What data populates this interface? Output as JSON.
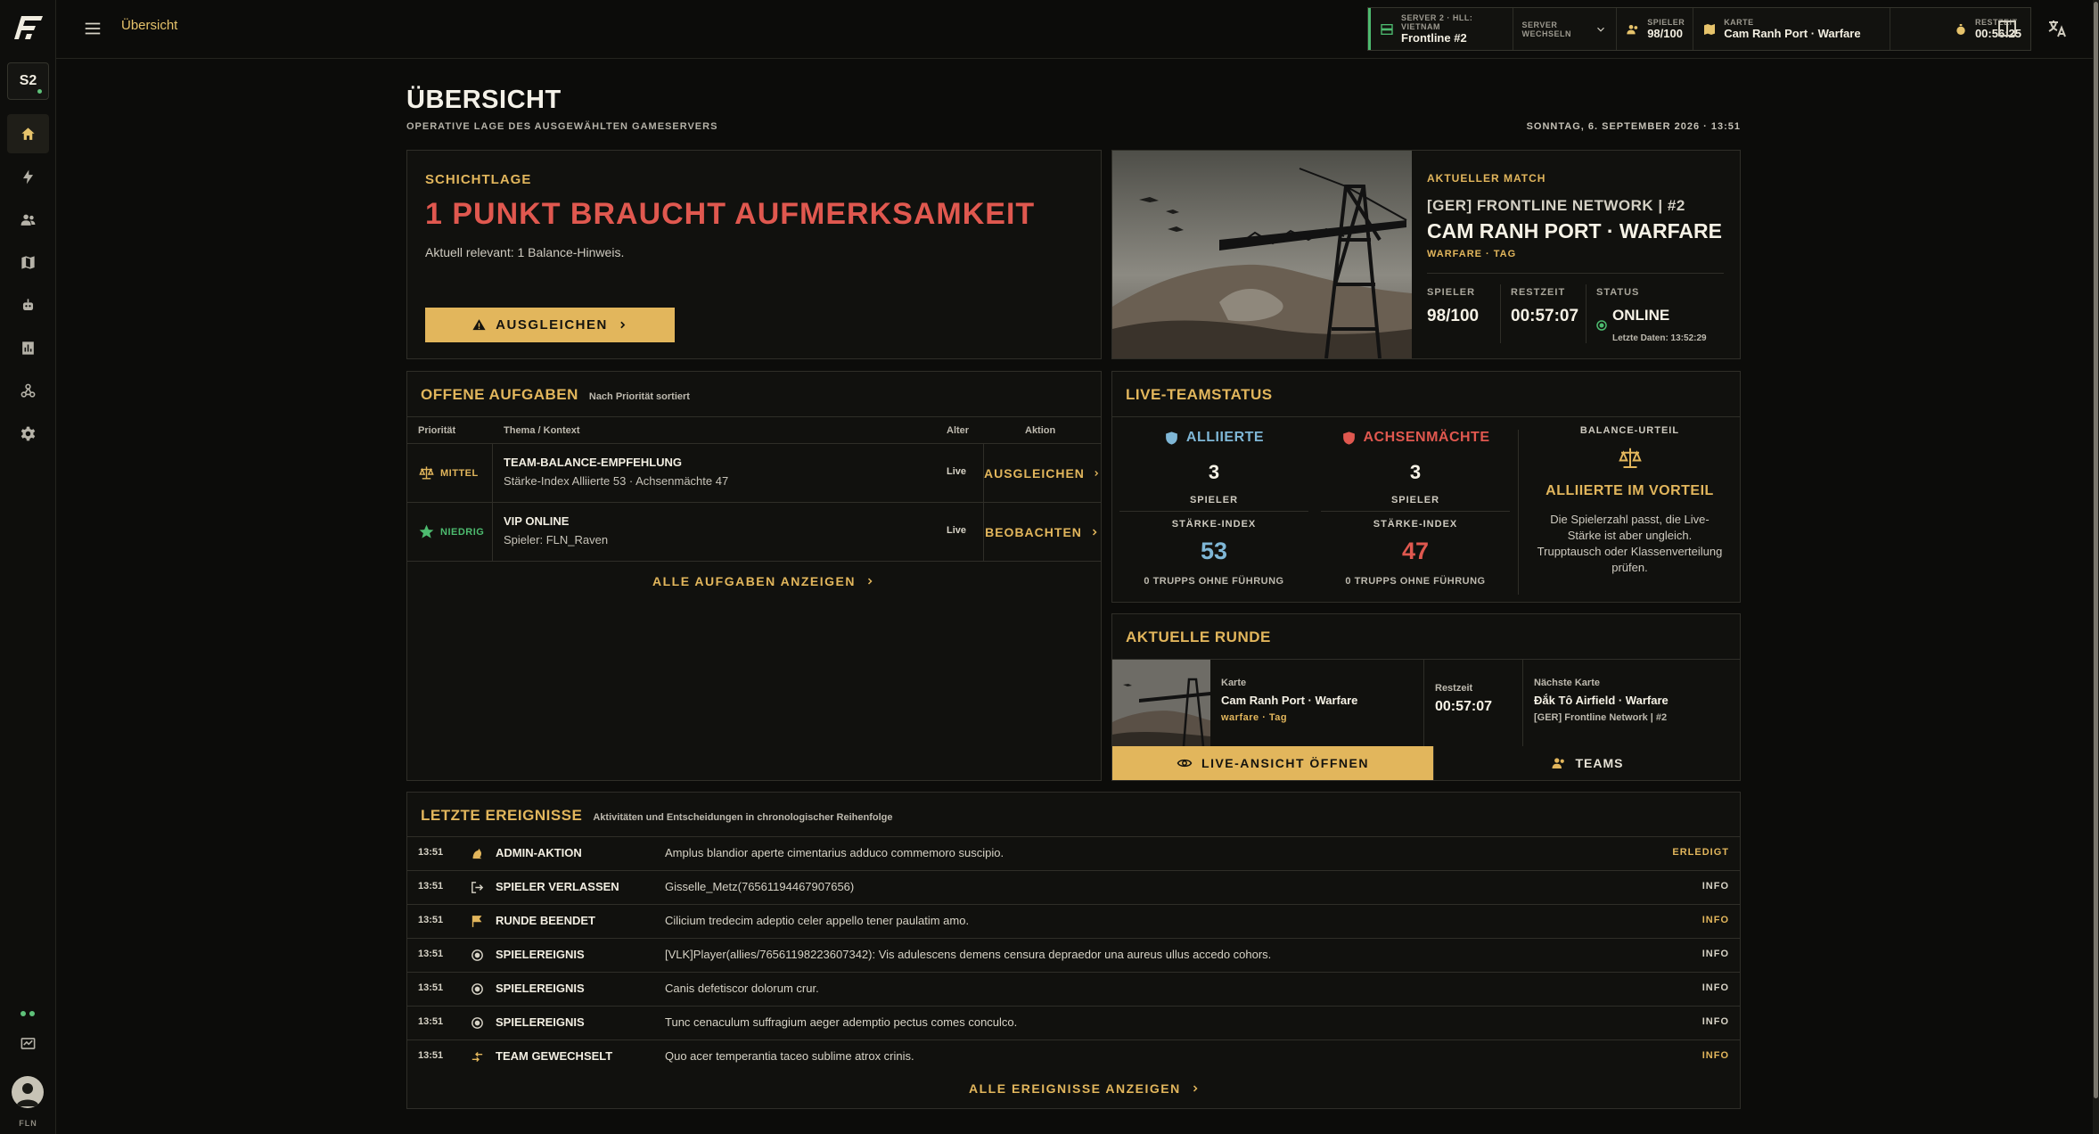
{
  "sidebar": {
    "server_badge": "S2",
    "user_label": "FLN"
  },
  "topbar": {
    "breadcrumb": "Übersicht"
  },
  "hud": {
    "server_label": "SERVER 2 · HLL: VIETNAM",
    "server_name": "Frontline #2",
    "switch_label": "SERVER WECHSELN",
    "players_label": "SPIELER",
    "players_value": "98/100",
    "map_label": "KARTE",
    "map_value": "Cam Ranh Port · Warfare",
    "time_label": "RESTZEIT",
    "time_value": "00:56:25"
  },
  "page": {
    "title": "ÜBERSICHT",
    "subtitle": "OPERATIVE LAGE DES AUSGEWÄHLTEN GAMESERVERS",
    "date": "SONNTAG, 6. SEPTEMBER 2026 · 13:51"
  },
  "alert": {
    "kicker": "SCHICHTLAGE",
    "title": "1 PUNKT BRAUCHT AUFMERKSAMKEIT",
    "text": "Aktuell relevant: 1 Balance-Hinweis.",
    "button": "AUSGLEICHEN"
  },
  "match": {
    "kicker": "AKTUELLER MATCH",
    "server": "[GER] FRONTLINE NETWORK | #2",
    "map": "CAM RANH PORT · WARFARE",
    "mode": "WARFARE · TAG",
    "players_label": "SPIELER",
    "players_value": "98/100",
    "time_label": "RESTZEIT",
    "time_value": "00:57:07",
    "status_label": "STATUS",
    "status_value": "ONLINE",
    "last_data": "Letzte Daten: 13:52:29"
  },
  "tasks": {
    "title": "OFFENE AUFGABEN",
    "sort": "Nach Priorität sortiert",
    "col_priority": "Priorität",
    "col_topic": "Thema / Kontext",
    "col_age": "Alter",
    "col_action": "Aktion",
    "rows": [
      {
        "priority": "MITTEL",
        "title": "TEAM-BALANCE-EMPFEHLUNG",
        "sub": "Stärke-Index Alliierte 53 · Achsenmächte 47",
        "age": "Live",
        "action": "AUSGLEICHEN"
      },
      {
        "priority": "NIEDRIG",
        "title": "VIP ONLINE",
        "sub": "Spieler: FLN_Raven",
        "age": "Live",
        "action": "BEOBACHTEN"
      }
    ],
    "all_link": "ALLE AUFGABEN ANZEIGEN"
  },
  "teams": {
    "title": "LIVE-TEAMSTATUS",
    "allies": {
      "name": "ALLIIERTE",
      "count": "3",
      "players_label": "SPIELER",
      "strength_label": "STÄRKE-INDEX",
      "strength": "53",
      "squads": "0 TRUPPS OHNE FÜHRUNG"
    },
    "axis": {
      "name": "ACHSENMÄCHTE",
      "count": "3",
      "players_label": "SPIELER",
      "strength_label": "STÄRKE-INDEX",
      "strength": "47",
      "squads": "0 TRUPPS OHNE FÜHRUNG"
    },
    "balance_label": "BALANCE-URTEIL",
    "balance_value": "ALLIIERTE IM VORTEIL",
    "balance_desc": "Die Spielerzahl passt, die Live-Stärke ist aber ungleich. Trupptausch oder Klassenverteilung prüfen."
  },
  "round": {
    "title": "AKTUELLE RUNDE",
    "map_label": "Karte",
    "map_value": "Cam Ranh Port · Warfare",
    "map_mode": "warfare · Tag",
    "time_label": "Restzeit",
    "time_value": "00:57:07",
    "next_label": "Nächste Karte",
    "next_value": "Đắk Tô Airfield · Warfare",
    "next_server": "[GER] Frontline Network | #2",
    "live_button": "LIVE-ANSICHT ÖFFNEN",
    "teams_button": "TEAMS"
  },
  "events": {
    "title": "LETZTE EREIGNISSE",
    "subtitle": "Aktivitäten und Entscheidungen in chronologischer Reihenfolge",
    "rows": [
      {
        "time": "13:51",
        "icon": "admin-icon",
        "type": "ADMIN-AKTION",
        "desc": "Amplus blandior aperte cimentarius adduco commemoro suscipio.",
        "status": "ERLEDIGT",
        "color": "#e2b65c"
      },
      {
        "time": "13:51",
        "icon": "leave-icon",
        "type": "SPIELER VERLASSEN",
        "desc": "Gisselle_Metz(76561194467907656)",
        "status": "INFO",
        "color": "#d7d3c6"
      },
      {
        "time": "13:51",
        "icon": "flag-icon",
        "type": "RUNDE BEENDET",
        "desc": "Cilicium tredecim adeptio celer appello tener paulatim amo.",
        "status": "INFO",
        "color": "#e2b65c"
      },
      {
        "time": "13:51",
        "icon": "target-icon",
        "type": "SPIELEREIGNIS",
        "desc": "[VLK]Player(allies/76561198223607342): Vis adulescens demens censura depraedor una aureus ullus accedo cohors.",
        "status": "INFO",
        "color": "#d7d3c6"
      },
      {
        "time": "13:51",
        "icon": "target-icon",
        "type": "SPIELEREIGNIS",
        "desc": "Canis defetiscor dolorum crur.",
        "status": "INFO",
        "color": "#d7d3c6"
      },
      {
        "time": "13:51",
        "icon": "target-icon",
        "type": "SPIELEREIGNIS",
        "desc": "Tunc cenaculum suffragium aeger ademptio pectus comes conculco.",
        "status": "INFO",
        "color": "#d7d3c6"
      },
      {
        "time": "13:51",
        "icon": "swap-icon",
        "type": "TEAM GEWECHSELT",
        "desc": "Quo acer temperantia taceo sublime atrox crinis.",
        "status": "INFO",
        "color": "#e2b65c"
      }
    ],
    "all_link": "ALLE EREIGNISSE ANZEIGEN"
  }
}
